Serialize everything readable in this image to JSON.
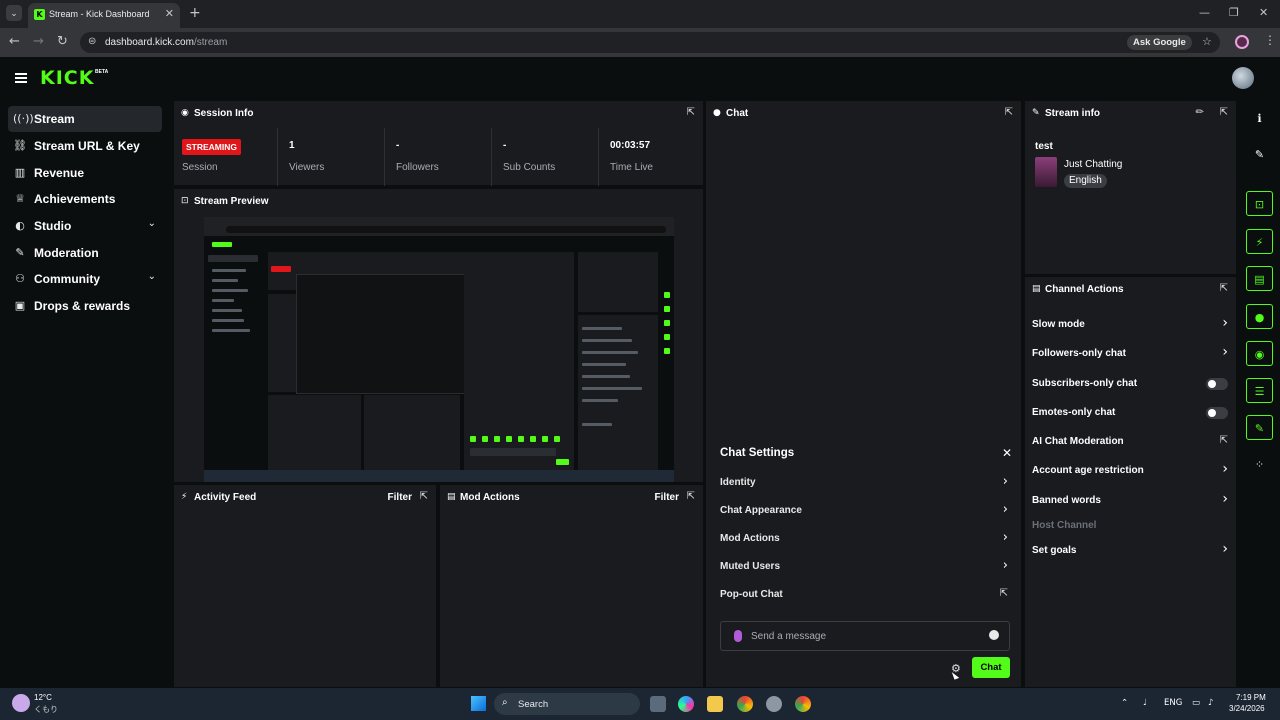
{
  "browser": {
    "tab_title": "Stream - Kick Dashboard",
    "url_host": "dashboard.kick.com",
    "url_path": "/stream",
    "ask_google": "Ask Google"
  },
  "app": {
    "logo": "KICK",
    "logo_badge": "BETA"
  },
  "sidebar": {
    "items": [
      {
        "label": "Stream",
        "icon": "broadcast-icon",
        "glyph": "((·))",
        "active": true
      },
      {
        "label": "Stream URL & Key",
        "icon": "link-icon",
        "glyph": "🔗"
      },
      {
        "label": "Revenue",
        "icon": "chart-icon",
        "glyph": "▥"
      },
      {
        "label": "Achievements",
        "icon": "trophy-icon",
        "glyph": "🏆"
      },
      {
        "label": "Studio",
        "icon": "palette-icon",
        "glyph": "🎨",
        "expandable": true
      },
      {
        "label": "Moderation",
        "icon": "wrench-icon",
        "glyph": "🔧"
      },
      {
        "label": "Community",
        "icon": "users-icon",
        "glyph": "👥",
        "expandable": true
      },
      {
        "label": "Drops & rewards",
        "icon": "gift-icon",
        "glyph": "🎁"
      }
    ]
  },
  "session_info": {
    "title": "Session Info",
    "status_badge": "STREAMING",
    "session_label": "Session",
    "stats": [
      {
        "value": "1",
        "label": "Viewers"
      },
      {
        "value": "-",
        "label": "Followers"
      },
      {
        "value": "-",
        "label": "Sub Counts"
      },
      {
        "value": "00:03:57",
        "label": "Time Live"
      }
    ]
  },
  "stream_preview": {
    "title": "Stream Preview"
  },
  "activity_feed": {
    "title": "Activity Feed",
    "filter": "Filter"
  },
  "mod_actions": {
    "title": "Mod Actions",
    "filter": "Filter"
  },
  "chat": {
    "title": "Chat",
    "settings": {
      "title": "Chat Settings",
      "items": [
        {
          "label": "Identity",
          "kind": "chevron"
        },
        {
          "label": "Chat Appearance",
          "kind": "chevron"
        },
        {
          "label": "Mod Actions",
          "kind": "chevron"
        },
        {
          "label": "Muted Users",
          "kind": "chevron"
        },
        {
          "label": "Pop-out Chat",
          "kind": "popout"
        }
      ]
    },
    "input_placeholder": "Send a message",
    "send_label": "Chat"
  },
  "stream_info": {
    "title": "Stream info",
    "stream_title": "test",
    "category": "Just Chatting",
    "language": "English"
  },
  "channel_actions": {
    "title": "Channel Actions",
    "items": [
      {
        "label": "Slow mode",
        "kind": "chevron"
      },
      {
        "label": "Followers-only chat",
        "kind": "chevron"
      },
      {
        "label": "Subscribers-only chat",
        "kind": "toggle",
        "on": false
      },
      {
        "label": "Emotes-only chat",
        "kind": "toggle",
        "on": false
      },
      {
        "label": "AI Chat Moderation",
        "kind": "popout"
      },
      {
        "label": "Account age restriction",
        "kind": "chevron"
      },
      {
        "label": "Banned words",
        "kind": "chevron"
      },
      {
        "label": "Host Channel",
        "kind": "disabled"
      },
      {
        "label": "Set goals",
        "kind": "chevron"
      }
    ]
  },
  "taskbar": {
    "weather_temp": "12°C",
    "weather_desc": "くもり",
    "search_label": "Search",
    "language": "ENG",
    "time": "7:19 PM",
    "date": "3/24/2026"
  },
  "colors": {
    "accent": "#53fc18",
    "live_badge": "#e0161b",
    "panel_bg": "#191b1f",
    "page_bg": "#0b0e0f"
  }
}
